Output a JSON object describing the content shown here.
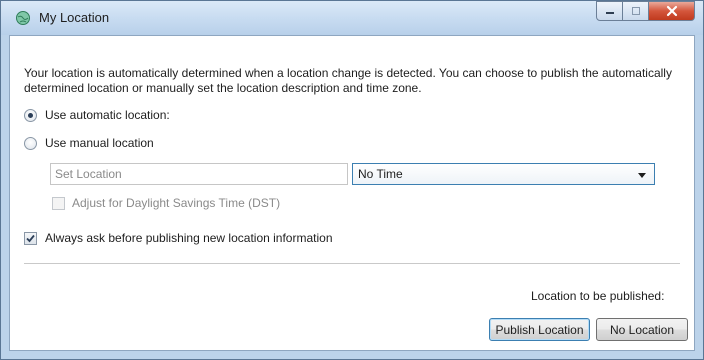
{
  "window": {
    "title": "My Location",
    "icon": "globe-icon",
    "controls": {
      "minimize": "minimize-icon",
      "maximize": "maximize-icon",
      "close": "close-icon"
    }
  },
  "description": "Your location is automatically determined when a location change is detected. You can choose to publish the automatically determined location or manually set the location description and time zone.",
  "options": {
    "automatic_label": "Use automatic location:",
    "automatic_selected": true,
    "manual_label": "Use manual location",
    "manual_selected": false
  },
  "manual": {
    "location_placeholder": "Set Location",
    "timezone_value": "No Time",
    "dst_label": "Adjust for Daylight Savings Time (DST)",
    "dst_checked": false
  },
  "always_ask": {
    "label": "Always ask before publishing new location information",
    "checked": true
  },
  "publish_status_label": "Location to be published:",
  "buttons": {
    "publish": "Publish Location",
    "none": "No Location"
  },
  "colors": {
    "accent": "#3c7fb1",
    "close_button": "#c03a1e"
  }
}
